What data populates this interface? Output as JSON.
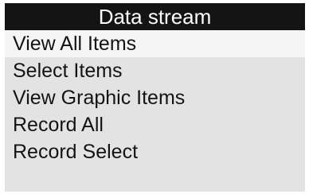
{
  "header": {
    "title": "Data stream"
  },
  "menu": {
    "selected_index": 0,
    "items": [
      {
        "label": "View All Items"
      },
      {
        "label": "Select Items"
      },
      {
        "label": "View Graphic Items"
      },
      {
        "label": "Record All"
      },
      {
        "label": "Record Select"
      }
    ]
  },
  "colors": {
    "title_background": "#141414",
    "title_text": "#ffffff",
    "screen_background": "#e3e3e3",
    "selected_background": "#f5f5f5",
    "item_text": "#141414"
  }
}
